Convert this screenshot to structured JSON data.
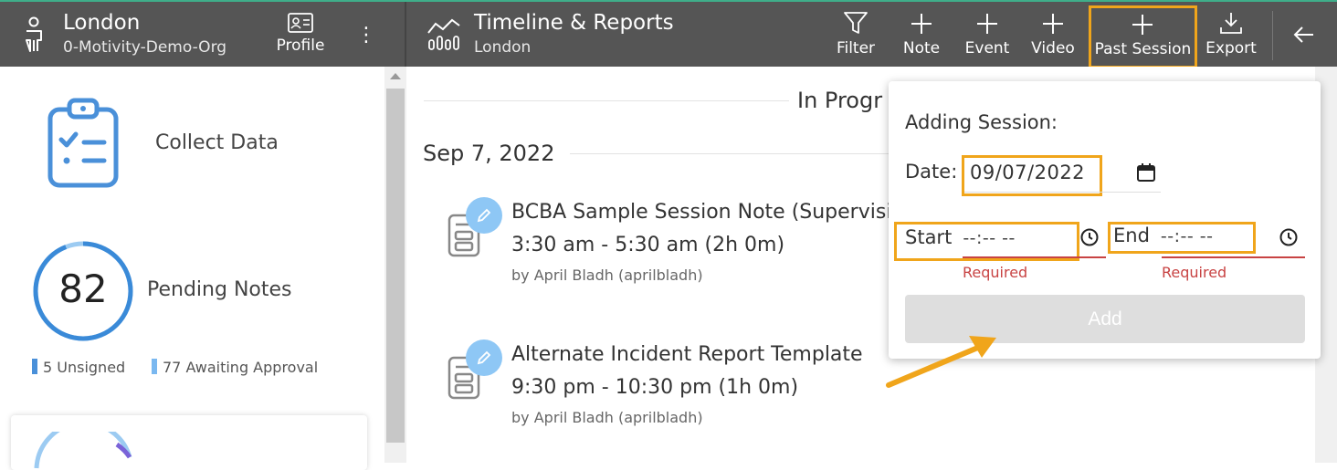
{
  "header": {
    "org_title": "London",
    "org_subtitle": "0-Motivity-Demo-Org",
    "profile_label": "Profile",
    "page_title": "Timeline & Reports",
    "page_subtitle": "London",
    "toolbar": {
      "filter_label": "Filter",
      "note_label": "Note",
      "event_label": "Event",
      "video_label": "Video",
      "past_session_label": "Past Session",
      "export_label": "Export"
    }
  },
  "sidebar": {
    "collect_label": "Collect Data",
    "pending_count": "82",
    "pending_label": "Pending Notes",
    "unsigned_label": "5 Unsigned",
    "awaiting_label": "77 Awaiting Approval",
    "pending_ring_fraction": 0.94
  },
  "timeline": {
    "section_label": "In Progr",
    "date_heading": "Sep 7, 2022",
    "entries": [
      {
        "title": "BCBA Sample Session Note (Supervisi",
        "time": "3:30 am - 5:30 am (2h 0m)",
        "author": "by April Bladh (aprilbladh)"
      },
      {
        "title": "Alternate Incident Report Template",
        "time": "9:30 pm - 10:30 pm (1h 0m)",
        "author": "by April Bladh (aprilbladh)"
      }
    ]
  },
  "popup": {
    "title": "Adding Session:",
    "date_label": "Date:",
    "date_value": "09/07/2022",
    "start_label": "Start",
    "start_placeholder": "--:-- --",
    "end_label": "End",
    "end_placeholder": "--:-- --",
    "required_start": "Required",
    "required_end": "Required",
    "add_label": "Add"
  },
  "colors": {
    "topbar": "#555555",
    "accent_blue": "#4a90d9",
    "highlight": "#f0a51b",
    "error": "#c84343"
  }
}
